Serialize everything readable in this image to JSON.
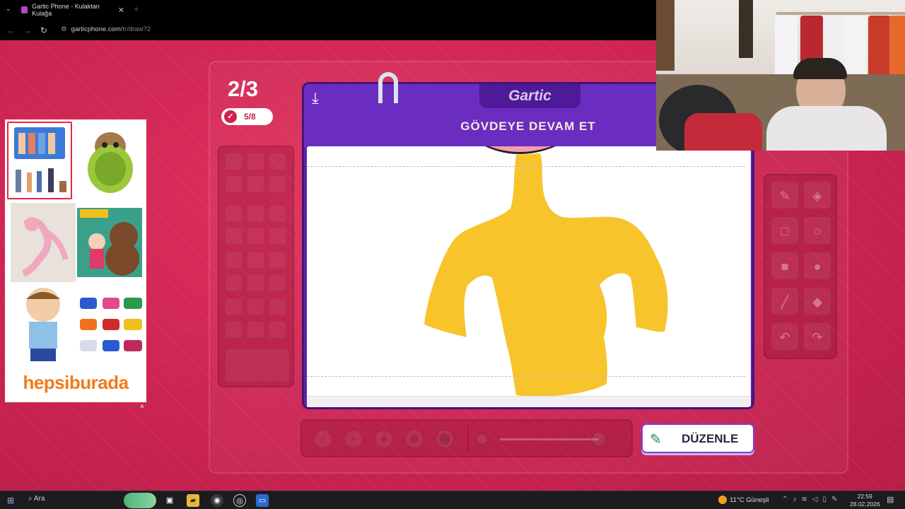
{
  "browser": {
    "tab_title": "Gartic Phone - Kulaktan Kulağa",
    "tab_close": "✕",
    "new_tab": "+",
    "url_host": "garticphone.com",
    "url_path": "/tr/draw?2"
  },
  "ad": {
    "brand": "hepsiburada",
    "badge": "A"
  },
  "game": {
    "round": "2/3",
    "players_done": "5/8",
    "logo": "Gartic",
    "instruction": "GÖVDEYE DEVAM ET",
    "edit_button": "DÜZENLE",
    "colors": {
      "background": "#cc2452",
      "board": "#6b2cc0",
      "drawing_fill": "#f7c42c"
    },
    "brush_sizes": 5,
    "opacity_slider": 1.0
  },
  "taskbar": {
    "search": "Ara",
    "weather": "11°C  Güneşli",
    "time": "22:59",
    "date": "28.02.2026"
  }
}
